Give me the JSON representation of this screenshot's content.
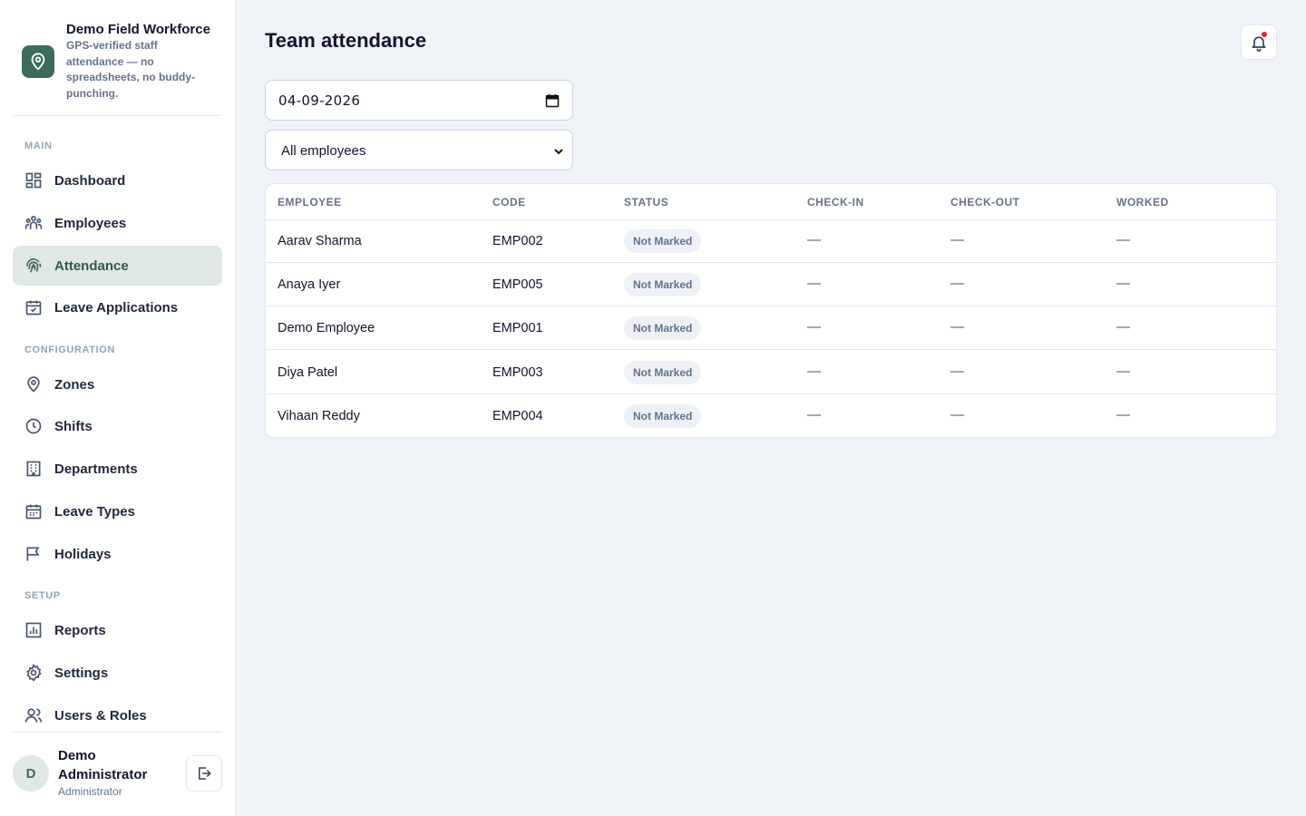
{
  "brand": {
    "title": "Demo Field Workforce",
    "subtitle": "GPS-verified staff attendance — no spreadsheets, no buddy-punching.",
    "logo_icon": "location-pin-icon",
    "accent_color": "#3e6b5b"
  },
  "sidebar": {
    "sections": {
      "main": "MAIN",
      "configuration": "CONFIGURATION",
      "setup": "SETUP"
    },
    "items": [
      {
        "label": "Dashboard",
        "icon": "dashboard-icon",
        "active": false
      },
      {
        "label": "Employees",
        "icon": "people-icon",
        "active": false
      },
      {
        "label": "Attendance",
        "icon": "fingerprint-icon",
        "active": true
      },
      {
        "label": "Leave Applications",
        "icon": "calendar-check-icon",
        "active": false
      },
      {
        "label": "Zones",
        "icon": "location-pin-icon",
        "active": false
      },
      {
        "label": "Shifts",
        "icon": "clock-icon",
        "active": false
      },
      {
        "label": "Departments",
        "icon": "building-icon",
        "active": false
      },
      {
        "label": "Leave Types",
        "icon": "calendar-icon",
        "active": false
      },
      {
        "label": "Holidays",
        "icon": "flag-icon",
        "active": false
      },
      {
        "label": "Reports",
        "icon": "bar-chart-icon",
        "active": false
      },
      {
        "label": "Settings",
        "icon": "gear-icon",
        "active": false
      },
      {
        "label": "Users & Roles",
        "icon": "users-icon",
        "active": false
      }
    ]
  },
  "user": {
    "initial": "D",
    "name": "Demo Administrator",
    "role": "Administrator"
  },
  "header": {
    "title": "Team attendance",
    "notification_icon": "bell-icon"
  },
  "filters": {
    "date_value": "04-09-2026",
    "employee_select": "All employees"
  },
  "table": {
    "columns": [
      "EMPLOYEE",
      "CODE",
      "STATUS",
      "CHECK-IN",
      "CHECK-OUT",
      "WORKED"
    ],
    "rows": [
      {
        "employee": "Aarav Sharma",
        "code": "EMP002",
        "status": "Not Marked",
        "check_in": "—",
        "check_out": "—",
        "worked": "—"
      },
      {
        "employee": "Anaya Iyer",
        "code": "EMP005",
        "status": "Not Marked",
        "check_in": "—",
        "check_out": "—",
        "worked": "—"
      },
      {
        "employee": "Demo Employee",
        "code": "EMP001",
        "status": "Not Marked",
        "check_in": "—",
        "check_out": "—",
        "worked": "—"
      },
      {
        "employee": "Diya Patel",
        "code": "EMP003",
        "status": "Not Marked",
        "check_in": "—",
        "check_out": "—",
        "worked": "—"
      },
      {
        "employee": "Vihaan Reddy",
        "code": "EMP004",
        "status": "Not Marked",
        "check_in": "—",
        "check_out": "—",
        "worked": "—"
      }
    ]
  }
}
